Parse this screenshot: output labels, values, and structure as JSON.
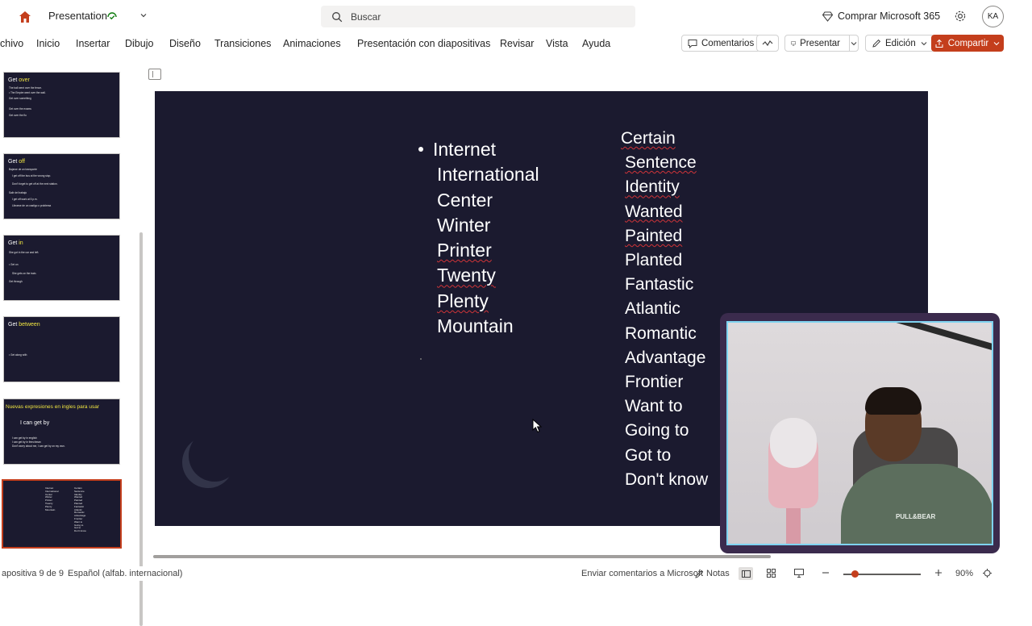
{
  "app": {
    "doc_title": "Presentation",
    "search_placeholder": "Buscar",
    "buy_label": "Comprar Microsoft 365",
    "avatar_initials": "KA",
    "accent_color": "#c43e1c"
  },
  "ribbon": {
    "tabs": [
      "chivo",
      "Inicio",
      "Insertar",
      "Dibujo",
      "Diseño",
      "Transiciones",
      "Animaciones",
      "Presentación con diapositivas",
      "Revisar",
      "Vista",
      "Ayuda"
    ],
    "comments_label": "Comentarios",
    "present_label": "Presentar",
    "edit_label": "Edición",
    "share_label": "Compartir"
  },
  "thumbnails": [
    {
      "title": "Get ",
      "title_hl": "over"
    },
    {
      "title": "Get ",
      "title_hl": "off"
    },
    {
      "title": "Get ",
      "title_hl": "in"
    },
    {
      "title": "Get ",
      "title_hl": "between"
    },
    {
      "title": "Nuevas expresiones en ingles para usar",
      "title_hl": "",
      "subtitle": "I can get by"
    },
    {
      "title": "",
      "title_hl": ""
    }
  ],
  "thumb_texts": {
    "t1": [
      "Get over",
      "The ball went over the fence.",
      "• The Empire went over the wall.",
      "Get over something",
      "Get over the exams",
      "Get over the flu"
    ],
    "t2": [
      "Bajarse de un transporte",
      "I get off the bus at the wrong stop.",
      "Don't forget to get off at the next station.",
      "Salir del trabajo",
      "I get off work at 5 p.m.",
      "Librarse de un castigo o problema"
    ],
    "t3": [
      "She got in the car and left.",
      "• Get on",
      "She gets on the train.",
      "Get through"
    ],
    "t4": [
      "• Get along with"
    ],
    "t5": [
      "I can get by in english",
      "I can get by in frenchman",
      "Don't worry about me, I can get by on my own."
    ]
  },
  "slide": {
    "col1": [
      "Internet",
      "International",
      "Center",
      "Winter",
      "Printer",
      "Twenty",
      "Plenty",
      "Mountain"
    ],
    "col2": [
      "Certain",
      "Sentence",
      "Identity",
      "Wanted",
      "Painted",
      "Planted",
      "Fantastic",
      "Atlantic",
      "Romantic",
      "Advantage",
      "Frontier",
      "Want to",
      "Going to",
      "Got to",
      "Don't know"
    ]
  },
  "webcam": {
    "shirt_logo": "PULL&BEAR"
  },
  "status": {
    "slide_counter": "apositiva 9 de 9",
    "language": "Español (alfab. internacional)",
    "feedback": "Enviar comentarios a Microsoft",
    "notes": "Notas",
    "zoom": "90%",
    "zoom_level": 0.15
  }
}
